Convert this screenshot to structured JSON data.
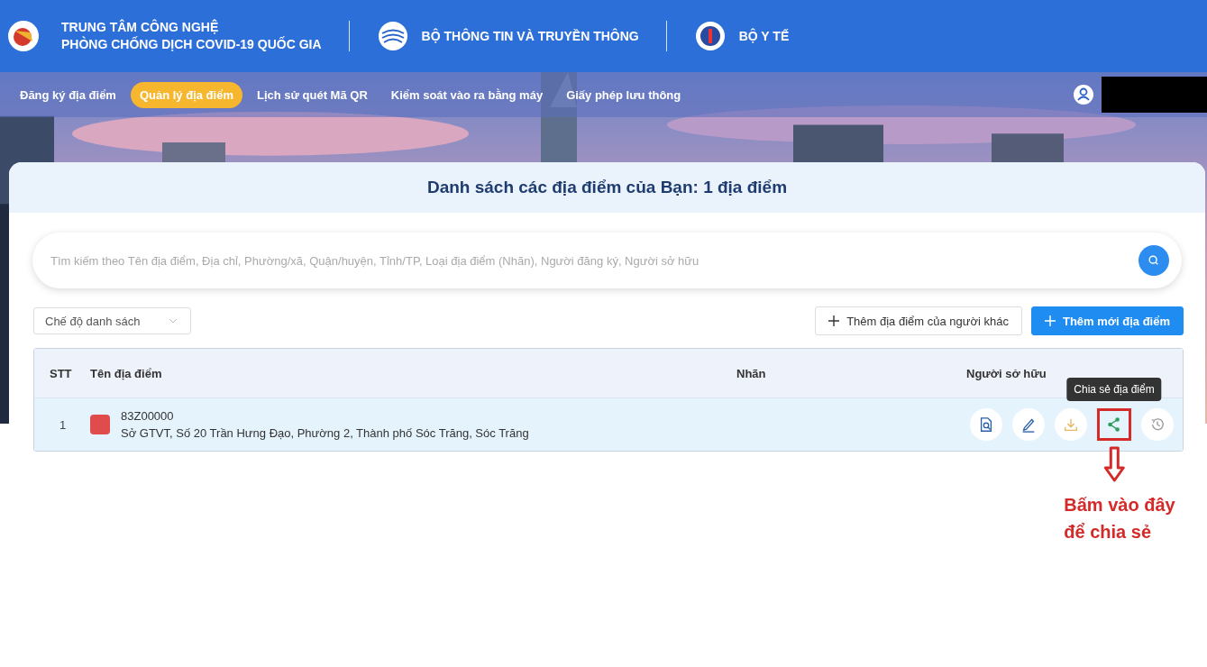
{
  "header": {
    "brand_lines": [
      "TRUNG TÂM CÔNG NGHỆ",
      "PHÒNG CHỐNG DỊCH COVID-19 QUỐC GIA"
    ],
    "partners": [
      "BỘ THÔNG TIN VÀ TRUYỀN THÔNG",
      "BỘ Y TẾ"
    ]
  },
  "nav": {
    "items": [
      {
        "label": "Đăng ký địa điểm",
        "selected": false
      },
      {
        "label": "Quản lý địa điểm",
        "selected": true
      },
      {
        "label": "Lịch sử quét Mã QR",
        "selected": false
      },
      {
        "label": "Kiểm soát vào ra bằng máy",
        "selected": false
      },
      {
        "label": "Giấy phép lưu thông",
        "selected": false
      }
    ]
  },
  "card": {
    "title": "Danh sách các địa điểm của Bạn: 1 địa điểm",
    "search": {
      "placeholder": "Tìm kiếm theo Tên địa điểm, Địa chỉ, Phường/xã, Quận/huyện, Tỉnh/TP, Loại địa điểm (Nhãn), Người đăng ký, Người sở hữu"
    },
    "view_mode": "Chế độ danh sách",
    "buttons": [
      {
        "label": "Thêm địa điểm của người khác",
        "kind": "outline"
      },
      {
        "label": "Thêm mới địa điểm",
        "kind": "primary"
      }
    ],
    "table": {
      "columns": [
        "STT",
        "Tên địa điểm",
        "Nhãn",
        "Người sở hữu"
      ],
      "rows": [
        {
          "stt": "1",
          "code": "83Z00000",
          "address": "Sở GTVT, Số 20 Trần Hưng Đạo, Phường 2, Thành phố Sóc Trăng, Sóc Trăng",
          "color": "#e04b4b",
          "actions": [
            {
              "kind": "view",
              "highlighted": false
            },
            {
              "kind": "edit",
              "highlighted": false
            },
            {
              "kind": "download",
              "highlighted": false
            },
            {
              "kind": "share",
              "highlighted": true,
              "tooltip": "Chia sẻ địa điểm",
              "annotation": [
                "Bấm vào đây",
                "để chia sẻ"
              ]
            },
            {
              "kind": "history",
              "highlighted": false
            }
          ]
        }
      ]
    }
  }
}
